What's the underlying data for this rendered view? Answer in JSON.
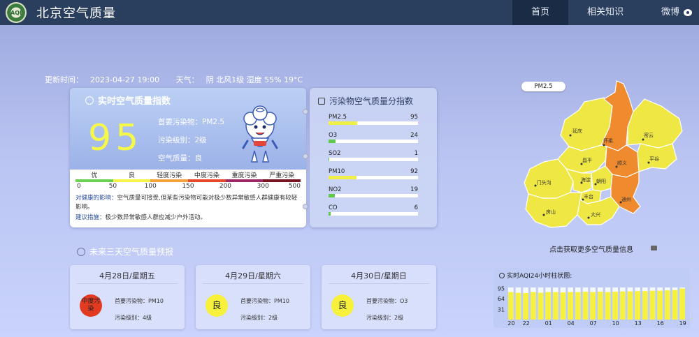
{
  "header": {
    "logo_text": "AQI",
    "title": "北京空气质量",
    "nav": [
      "首页",
      "相关知识",
      "微博"
    ]
  },
  "update": {
    "time_label": "更新时间：",
    "time": "2023-04-27 19:00",
    "weather_label": "天气：",
    "weather": "阴 北风1级 湿度 55% 19°C"
  },
  "realtime": {
    "title": "实时空气质量指数",
    "aqi": "95",
    "primary_label": "首要污染物：",
    "primary": "PM2.5",
    "level_label": "污染级别：",
    "level": "2级",
    "quality_label": "空气质量：",
    "quality": "良",
    "scale_labels": [
      "优",
      "良",
      "轻度污染",
      "中度污染",
      "重度污染",
      "严重污染"
    ],
    "scale_colors": [
      "#6bd150",
      "#f6f34a",
      "#f5a23a",
      "#e64a2a",
      "#a02766",
      "#7a1320"
    ],
    "scale_numbers": [
      "0",
      "50",
      "100",
      "150",
      "200",
      "300",
      "500"
    ],
    "health_label": "对健康的影响：",
    "health": "空气质量可接受,但某些污染物可能对极少数异常敏感人群健康有较轻影响。",
    "advice_label": "建议措施：",
    "advice": "极少数异常敏感人群应减少户外活动。"
  },
  "pollutants": {
    "title": "污染物空气质量分指数",
    "items": [
      {
        "name": "PM2.5",
        "value": "95",
        "fraction": 0.32,
        "color": "#f0ef45"
      },
      {
        "name": "O3",
        "value": "24",
        "fraction": 0.08,
        "color": "#5ec94a"
      },
      {
        "name": "SO2",
        "value": "1",
        "fraction": 0.01,
        "color": "#5ec94a"
      },
      {
        "name": "PM10",
        "value": "92",
        "fraction": 0.31,
        "color": "#f0ef45"
      },
      {
        "name": "NO2",
        "value": "19",
        "fraction": 0.07,
        "color": "#5ec94a"
      },
      {
        "name": "CO",
        "value": "6",
        "fraction": 0.02,
        "color": "#5ec94a"
      }
    ]
  },
  "forecast": {
    "title": "未来三天空气质量预报",
    "days": [
      {
        "date": "4月28日/星期五",
        "badge": "中度污染",
        "badge_color": "#e23b22",
        "primary_label": "首要污染物：",
        "primary": "PM10",
        "level_label": "污染级别：",
        "level": "4级"
      },
      {
        "date": "4月29日/星期六",
        "badge": "良",
        "badge_color": "#f7f13c",
        "primary_label": "首要污染物：",
        "primary": "PM10",
        "level_label": "污染级别：",
        "level": "2级"
      },
      {
        "date": "4月30日/星期日",
        "badge": "良",
        "badge_color": "#f7f13c",
        "primary_label": "首要污染物：",
        "primary": "O3",
        "level_label": "污染级别：",
        "level": "2级"
      }
    ]
  },
  "map": {
    "tag": "PM2.5",
    "districts": [
      {
        "name": "延庆",
        "color": "#efe743"
      },
      {
        "name": "怀柔",
        "color": "#ef8a2e"
      },
      {
        "name": "密云",
        "color": "#efe743"
      },
      {
        "name": "昌平",
        "color": "#efe743"
      },
      {
        "name": "顺义",
        "color": "#ef8a2e"
      },
      {
        "name": "平谷",
        "color": "#efe743"
      },
      {
        "name": "门头沟",
        "color": "#efe743"
      },
      {
        "name": "海淀",
        "color": "#efe743"
      },
      {
        "name": "朝阳",
        "color": "#efe743"
      },
      {
        "name": "丰台",
        "color": "#efe743"
      },
      {
        "name": "通州",
        "color": "#ef8a2e"
      },
      {
        "name": "房山",
        "color": "#efe743"
      },
      {
        "name": "大兴",
        "color": "#efe743"
      }
    ],
    "link": "点击获取更多空气质量信息"
  },
  "hourly": {
    "title": "实时AQI24小时柱状图:",
    "y_ticks": [
      "95",
      "64",
      "31"
    ],
    "x_ticks": [
      "20",
      "22",
      "01",
      "04",
      "07",
      "10",
      "13",
      "16",
      "19"
    ],
    "bar_color": "#f6f13f"
  },
  "chart_data": {
    "type": "bar",
    "title": "实时AQI24小时柱状图:",
    "categories": [
      "20",
      "21",
      "22",
      "23",
      "00",
      "01",
      "02",
      "03",
      "04",
      "05",
      "06",
      "07",
      "08",
      "09",
      "10",
      "11",
      "12",
      "13",
      "14",
      "15",
      "16",
      "17",
      "18",
      "19"
    ],
    "values": [
      84,
      82,
      81,
      84,
      82,
      84,
      84,
      83,
      84,
      84,
      85,
      84,
      85,
      84,
      85,
      86,
      86,
      87,
      87,
      88,
      88,
      89,
      90,
      95
    ],
    "yticks": [
      31,
      64,
      95
    ],
    "ylim": [
      0,
      98
    ]
  }
}
